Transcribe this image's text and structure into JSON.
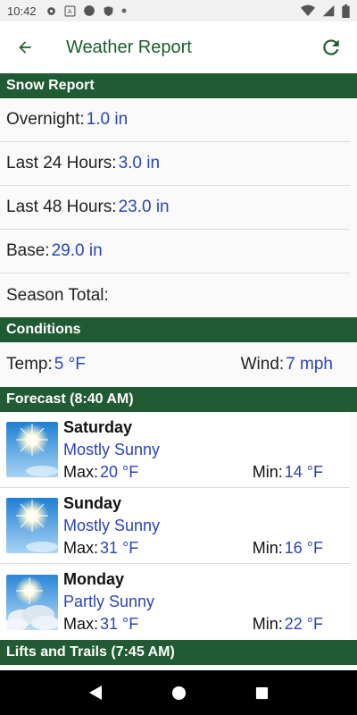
{
  "status": {
    "time": "10:42"
  },
  "appbar": {
    "title": "Weather Report"
  },
  "snow": {
    "header": "Snow Report",
    "rows": [
      {
        "label": "Overnight:",
        "value": "1.0 in"
      },
      {
        "label": "Last 24 Hours:",
        "value": "3.0 in"
      },
      {
        "label": "Last 48 Hours:",
        "value": "23.0 in"
      },
      {
        "label": "Base:",
        "value": "29.0 in"
      },
      {
        "label": "Season Total:",
        "value": ""
      }
    ]
  },
  "conditions": {
    "header": "Conditions",
    "temp_label": "Temp:",
    "temp_value": "5 °F",
    "wind_label": "Wind:",
    "wind_value": "7 mph"
  },
  "forecast": {
    "header": "Forecast (8:40 AM)",
    "max_label": "Max:",
    "min_label": "Min:",
    "days": [
      {
        "day": "Saturday",
        "desc": "Mostly Sunny",
        "max": "20 °F",
        "min": "14 °F",
        "icon": "sunny-icon"
      },
      {
        "day": "Sunday",
        "desc": "Mostly Sunny",
        "max": "31 °F",
        "min": "16 °F",
        "icon": "sunny-icon"
      },
      {
        "day": "Monday",
        "desc": "Partly Sunny",
        "max": "31 °F",
        "min": "22 °F",
        "icon": "partly-sunny-icon"
      }
    ]
  },
  "lifts": {
    "header": "Lifts and Trails (7:45 AM)"
  },
  "colors": {
    "accent": "#215b33",
    "title": "#1a5c2c",
    "value": "#2a44b8"
  }
}
